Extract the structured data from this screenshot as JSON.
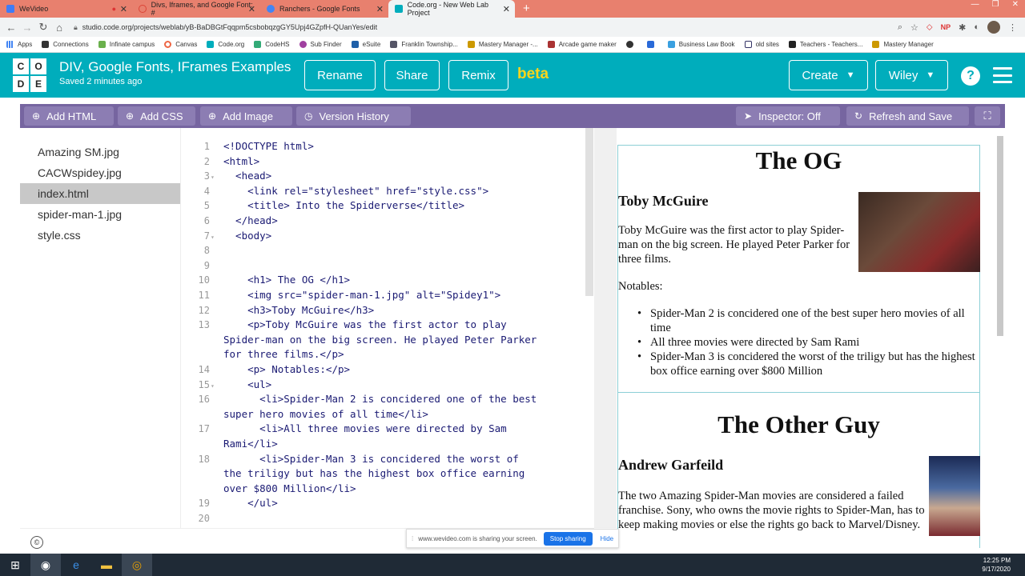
{
  "browser": {
    "tabs": [
      {
        "title": "WeVideo",
        "color": "#3f7cf6"
      },
      {
        "title": "Divs, Iframes, and Google Font: #",
        "color": "#db4437"
      },
      {
        "title": "Ranchers - Google Fonts",
        "color": "#4285f4"
      },
      {
        "title": "Code.org - New Web Lab Project",
        "color": "#00adbc"
      }
    ],
    "url": "studio.code.org/projects/weblab/yB-BaDBGtFqqpm5csbobqzgGY5Upj4GZpfH-QUanYes/edit",
    "bookmarks": [
      "Apps",
      "Connections",
      "Infinate campus",
      "Canvas",
      "Code.org",
      "CodeHS",
      "Sub Finder",
      "eSuite",
      "Franklin Township...",
      "Mastery Manager -...",
      "Arcade game maker",
      "Business Law Book",
      "old sites",
      "Teachers - Teachers...",
      "Mastery Manager"
    ]
  },
  "header": {
    "logo_letters": [
      "C",
      "O",
      "D",
      "E"
    ],
    "project_title": "DIV, Google Fonts, IFrames Examples",
    "saved": "Saved 2 minutes ago",
    "rename": "Rename",
    "share": "Share",
    "remix": "Remix",
    "beta": "beta",
    "create": "Create",
    "user": "Wiley"
  },
  "toolbar": {
    "add_html": "Add HTML",
    "add_css": "Add CSS",
    "add_image": "Add Image",
    "version_history": "Version History",
    "inspector": "Inspector: Off",
    "refresh": "Refresh and Save"
  },
  "files": [
    "Amazing SM.jpg",
    "CACWspidey.jpg",
    "index.html",
    "spider-man-1.jpg",
    "style.css"
  ],
  "selected_file": "index.html",
  "code_lines": [
    {
      "n": "1",
      "text": "<!DOCTYPE html>"
    },
    {
      "n": "2",
      "text": "<html>"
    },
    {
      "n": "3",
      "text": "  <head>"
    },
    {
      "n": "4",
      "text": "    <link rel=\"stylesheet\" href=\"style.css\">"
    },
    {
      "n": "5",
      "text": "    <title> Into the Spiderverse</title>"
    },
    {
      "n": "6",
      "text": "  </head>"
    },
    {
      "n": "7",
      "text": "  <body>"
    },
    {
      "n": "8",
      "text": ""
    },
    {
      "n": "9",
      "text": ""
    },
    {
      "n": "10",
      "text": "    <h1> The OG </h1>"
    },
    {
      "n": "11",
      "text": "    <img src=\"spider-man-1.jpg\" alt=\"Spidey1\">"
    },
    {
      "n": "12",
      "text": "    <h3>Toby McGuire</h3>"
    },
    {
      "n": "13",
      "text": "    <p>Toby McGuire was the first actor to play\nSpider-man on the big screen. He played Peter Parker\nfor three films.</p>"
    },
    {
      "n": "14",
      "text": "    <p> Notables:</p>"
    },
    {
      "n": "15",
      "text": "    <ul>"
    },
    {
      "n": "16",
      "text": "      <li>Spider-Man 2 is concidered one of the best\nsuper hero movies of all time</li>"
    },
    {
      "n": "17",
      "text": "      <li>All three movies were directed by Sam\nRami</li>"
    },
    {
      "n": "18",
      "text": "      <li>Spider-Man 3 is concidered the worst of\nthe triligy but has the highest box office earning\nover $800 Million</li>"
    },
    {
      "n": "19",
      "text": "    </ul>"
    },
    {
      "n": "20",
      "text": ""
    }
  ],
  "preview": {
    "h1a": "The OG",
    "h3a": "Toby McGuire",
    "pa": "Toby McGuire was the first actor to play Spider-man on the big screen. He played Peter Parker for three films.",
    "notables": "Notables:",
    "items": [
      "Spider-Man 2 is concidered one of the best super hero movies of all time",
      "All three movies were directed by Sam Rami",
      "Spider-Man 3 is concidered the worst of the triligy but has the highest box office earning over $800 Million"
    ],
    "h1b": "The Other Guy",
    "h3b": "Andrew Garfeild",
    "pb": "The two Amazing Spider-Man movies are considered a failed franchise. Sony, who owns the movie rights to Spider-Man, has to keep making movies or else the rights go back to Marvel/Disney."
  },
  "share_notice": {
    "text": "www.wevideo.com is sharing your screen.",
    "stop": "Stop sharing",
    "hide": "Hide"
  },
  "clock": {
    "time": "12:25 PM",
    "date": "9/17/2020"
  }
}
